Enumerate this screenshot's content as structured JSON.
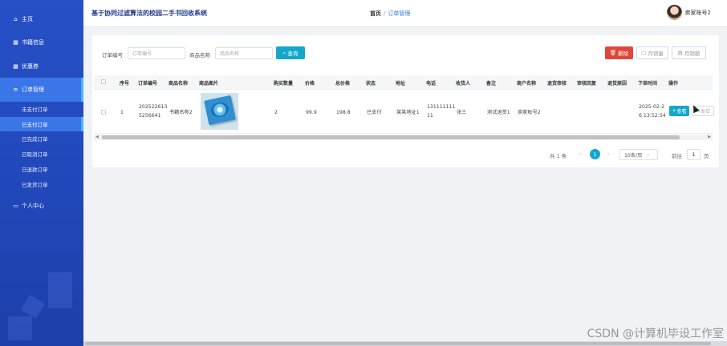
{
  "app": {
    "title": "基于协同过滤算法的校园二手书回收系统"
  },
  "breadcrumb": {
    "home": "首页",
    "separator": "/",
    "current": "订单管理"
  },
  "user": {
    "name": "卖家账号2"
  },
  "sidebar": {
    "items": [
      {
        "icon": "⌂",
        "label": "主页"
      },
      {
        "icon": "▦",
        "label": "书籍信息"
      },
      {
        "icon": "▦",
        "label": "优惠券"
      },
      {
        "icon": "≡",
        "label": "订单管理"
      },
      {
        "icon": "▭",
        "label": "个人中心"
      }
    ],
    "sub_items": [
      "未支付订单",
      "已支付订单",
      "已完成订单",
      "已取消订单",
      "已退款订单",
      "已发货订单"
    ]
  },
  "search": {
    "order_no_label": "订单编号",
    "order_no_placeholder": "订单编号",
    "goods_name_label": "商品名称",
    "goods_name_placeholder": "商品名称",
    "search_button": "查询"
  },
  "actions": {
    "delete": "删除",
    "monthly_volume": "月销量",
    "monthly_sales": "月销额"
  },
  "table": {
    "headers": [
      "序号",
      "订单编号",
      "商品名称",
      "商品图片",
      "购买数量",
      "价格",
      "总价格",
      "状态",
      "地址",
      "电话",
      "收货人",
      "备注",
      "商户名称",
      "退货审核",
      "审核回复",
      "退货原因",
      "下单时间",
      "操作"
    ],
    "rows": [
      {
        "index": "1",
        "order_no_1": "202522613",
        "order_no_2": "5256641",
        "goods_name": "书籍名称2",
        "quantity": "2",
        "price": "99.9",
        "total": "198.8",
        "status": "已支付",
        "address": "某某地址1",
        "phone_1": "131111111",
        "phone_2": "11",
        "receiver": "张三",
        "remark": "测试退货1",
        "merchant": "卖家账号2",
        "order_time_1": "2025-02-2",
        "order_time_2": "6 13:52:54",
        "view_button": "查看",
        "ship_button": "发货"
      }
    ]
  },
  "pagination": {
    "total": "共 1 条",
    "prev": "‹",
    "current": "1",
    "next": "›",
    "page_size": "10条/页",
    "goto_label": "前往",
    "goto_value": "1",
    "page_unit": "页"
  },
  "watermark": "CSDN @计算机毕设工作室",
  "colors": {
    "sidebar": "#2750c7",
    "accent": "#14a7c9",
    "danger": "#e0473b",
    "active": "#3a76e8"
  },
  "icons": {
    "search": "search-icon",
    "delete": "trash-icon",
    "chart": "chart-icon",
    "plus": "plus-icon",
    "ship": "truck-icon"
  }
}
